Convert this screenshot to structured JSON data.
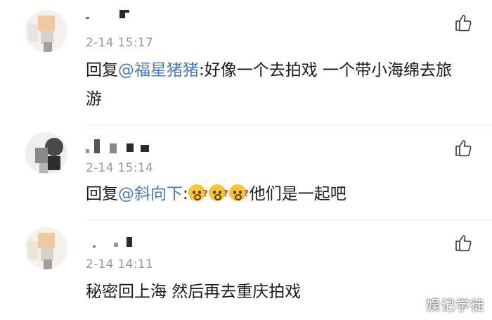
{
  "comments": [
    {
      "time": "2-14 15:17",
      "reply_prefix": "回复",
      "mention": "@福星猪猪",
      "text": ":好像一个去拍戏 一个带小海绵去旅游"
    },
    {
      "time": "2-14 15:14",
      "reply_prefix": "回复",
      "mention": "@斜向下",
      "text_prefix": ":",
      "emoji_name": "confused-question-emoji",
      "text": "他们是一起吧"
    },
    {
      "time": "2-14 14:11",
      "text": "秘密回上海 然后再去重庆拍戏"
    }
  ],
  "watermark": "娱记学徒",
  "colors": {
    "mention": "#4a7bb7",
    "time": "#9a9a9a",
    "divider": "#e8e8e8"
  }
}
